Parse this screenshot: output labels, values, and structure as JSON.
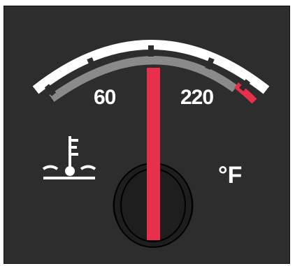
{
  "gauge": {
    "type": "coolant-temperature",
    "icon": "coolant-temperature-icon",
    "unit": "°F",
    "tick_labels": [
      "60",
      "220"
    ],
    "needle_position": 0.5,
    "colors": {
      "background": "#2d2d2d",
      "bezel": "#ffffff",
      "scale": "#8a8a8a",
      "redline": "#e8304c",
      "needle": "#e8304c",
      "text": "#ffffff",
      "knob": "#1e1e1e"
    }
  }
}
